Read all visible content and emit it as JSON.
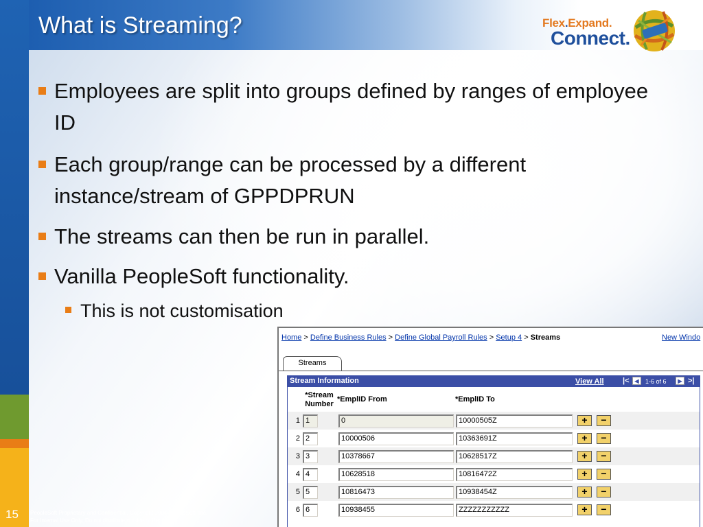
{
  "slide": {
    "title": "What is Streaming?",
    "logo": {
      "word1": "Flex",
      "word2": "Expand.",
      "word3": "Connect."
    },
    "bullets": [
      {
        "text": "Employees are split into groups defined by ranges of employee ID"
      },
      {
        "text": "Each group/range can be processed by a different instance/stream of GPPDPRUN"
      },
      {
        "text": "The streams can then be run in parallel."
      },
      {
        "text": "Vanilla PeopleSoft functionality."
      }
    ],
    "sub_bullets": [
      {
        "text": "This is not customisation"
      }
    ],
    "page_number": "15",
    "footer": {
      "line1": "PeopleSoft Proprietary and Confidential, Copyright 2004 PeopleSoft, Inc.",
      "line2": "For Internal Use Only, Do not distribute outside of PeopleSoft."
    },
    "colors": {
      "accent": "#e97d16",
      "title_blue": "#1d5eb0",
      "band_green": "#6f9a2f",
      "band_yellow": "#f5b21a"
    }
  },
  "peoplesoft": {
    "breadcrumb": {
      "home": "Home",
      "sep": ">",
      "define_business_rules": "Define Business Rules",
      "define_global_payroll_rules": "Define Global Payroll Rules",
      "setup4": "Setup 4",
      "current": "Streams"
    },
    "new_window": "New Windo",
    "tab_label": "Streams",
    "grid": {
      "title": "Stream Information",
      "view_all": "View All",
      "nav_first": "|<",
      "nav_prev_icon": "◀",
      "page_range": "1-6 of 6",
      "nav_next_icon": "▶",
      "nav_last": ">|",
      "col_stream_line1": "*Stream",
      "col_stream_line2": "Number",
      "col_from": "*EmplID From",
      "col_to": "*EmplID To",
      "add_label": "+",
      "delete_label": "−",
      "rows": [
        {
          "num": "1",
          "stream": "1",
          "from": "0",
          "to": "10000505Z"
        },
        {
          "num": "2",
          "stream": "2",
          "from": "10000506",
          "to": "10363691Z"
        },
        {
          "num": "3",
          "stream": "3",
          "from": "10378667",
          "to": "10628517Z"
        },
        {
          "num": "4",
          "stream": "4",
          "from": "10628518",
          "to": "10816472Z"
        },
        {
          "num": "5",
          "stream": "5",
          "from": "10816473",
          "to": "10938454Z"
        },
        {
          "num": "6",
          "stream": "6",
          "from": "10938455",
          "to": "ZZZZZZZZZZZ"
        }
      ]
    },
    "colors": {
      "grid_header": "#3b4ea6",
      "button_fill": "#f2d16a",
      "link": "#0033aa"
    }
  }
}
